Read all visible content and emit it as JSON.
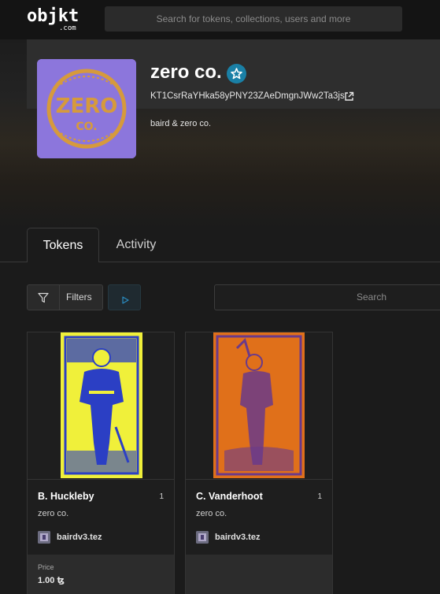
{
  "header": {
    "logo_main": "objkt",
    "logo_sub": ".com",
    "search_placeholder": "Search for tokens, collections, users and more"
  },
  "collection": {
    "title": "zero co.",
    "address": "KT1CsrRaYHka58yPNY23ZAeDmgnJWw2Ta3js",
    "description": "baird & zero co.",
    "avatar_text_top": "ZERO",
    "avatar_text_bottom": "CO."
  },
  "tabs": [
    {
      "label": "Tokens",
      "active": true
    },
    {
      "label": "Activity",
      "active": false
    }
  ],
  "toolbar": {
    "filters_label": "Filters",
    "search_placeholder": "Search"
  },
  "tokens": [
    {
      "name": "B. Huckleby",
      "edition": "1",
      "collection": "zero co.",
      "creator": "bairdv3.tez",
      "price_label": "Price",
      "price": "1.00 ꜩ",
      "image_colors": [
        "#f0f03a",
        "#2b3fc4"
      ]
    },
    {
      "name": "C. Vanderhoot",
      "edition": "1",
      "collection": "zero co.",
      "creator": "bairdv3.tez",
      "image_colors": [
        "#e0701a",
        "#6a3a8a"
      ]
    }
  ],
  "colors": {
    "background": "#1b1b1b",
    "topbar": "#141414",
    "accent_verified": "#1a80a6",
    "avatar_bg": "#8c76dc",
    "avatar_fg": "#d69a3c"
  }
}
